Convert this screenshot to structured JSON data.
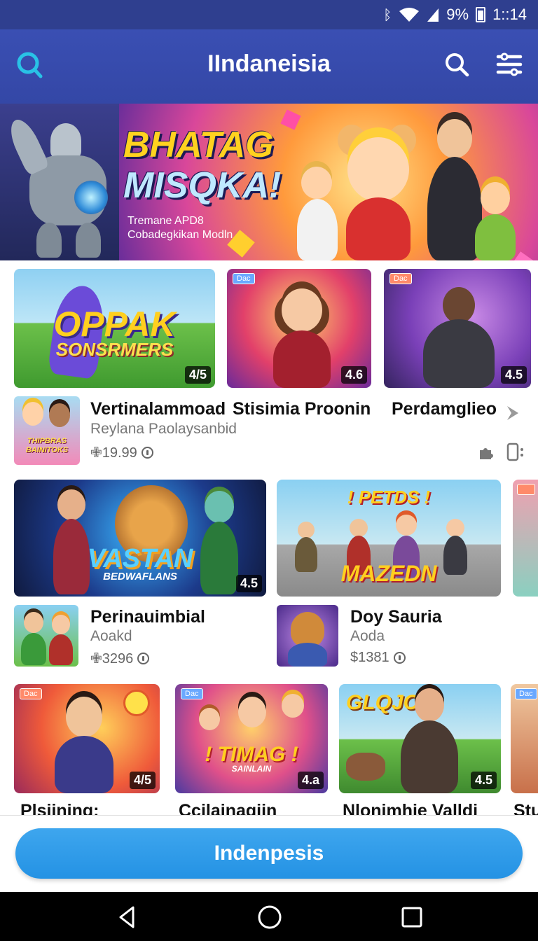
{
  "status_bar": {
    "battery": "9%",
    "time": "1::14",
    "icons": [
      "bluetooth-icon",
      "wifi-icon",
      "signal-icon",
      "battery-icon"
    ]
  },
  "app_bar": {
    "title": "IIndaneisia",
    "logo_icon": "app-logo-icon",
    "search_icon": "search-icon",
    "menu_icon": "menu-icon"
  },
  "banner": {
    "title_line1": "BHATAG",
    "title_line2": "MISQKA!",
    "subtitle_line1": "Tremane APD8",
    "subtitle_line2": "Cobadegkikan Modln"
  },
  "row1": {
    "tiles": [
      {
        "art_line1": "OPPAK",
        "art_line2": "SONSRMERS",
        "rating": "4/5"
      },
      {
        "tag": "Dac",
        "rating": "4.6"
      },
      {
        "tag": "Dac",
        "rating": "4.5"
      }
    ],
    "featured": {
      "thumb_text": "THIPBRAS BAINITOKS",
      "names": [
        "Vertinalammoad",
        "Stisimia Proonin",
        "Perdamglieo"
      ],
      "subtitle": "Reylana Paolaysanbid",
      "price": "✙19.99"
    }
  },
  "row2": {
    "tiles": [
      {
        "art_line1": "VASTAN",
        "art_line2": "BEDWAFLANS",
        "rating": "4.5"
      },
      {
        "art_line1": "! PETDS !",
        "art_line2": "MAZEDN"
      }
    ],
    "items": [
      {
        "name": "Perinauimbial",
        "subtitle": "Aoakd",
        "price": "✙3296"
      },
      {
        "name": "Doy Sauria",
        "subtitle": "Aoda",
        "price": "$1381"
      }
    ]
  },
  "row3": {
    "tiles": [
      {
        "tag": "Dac",
        "rating": "4/5"
      },
      {
        "tag": "Dac",
        "art_line1": "! TIMAG !",
        "art_line2": "SAINLAIN",
        "rating": "4.a"
      },
      {
        "art_line1": "GLQJCS",
        "rating": "4.5"
      },
      {
        "tag": "Dac"
      }
    ],
    "names": [
      "Plsiining:",
      "Ccilainagiin",
      "Nlonimhie Valldi",
      "Stu"
    ]
  },
  "cta": {
    "label": "Indenpesis"
  },
  "nav": {
    "back_icon": "back-icon",
    "home_icon": "home-icon",
    "recents_icon": "recents-icon"
  },
  "colors": {
    "app_bar": "#3a4fb3",
    "status_bar": "#2f3f8f",
    "cta": "#2f9be9",
    "banner_title": "#ffd21f"
  }
}
